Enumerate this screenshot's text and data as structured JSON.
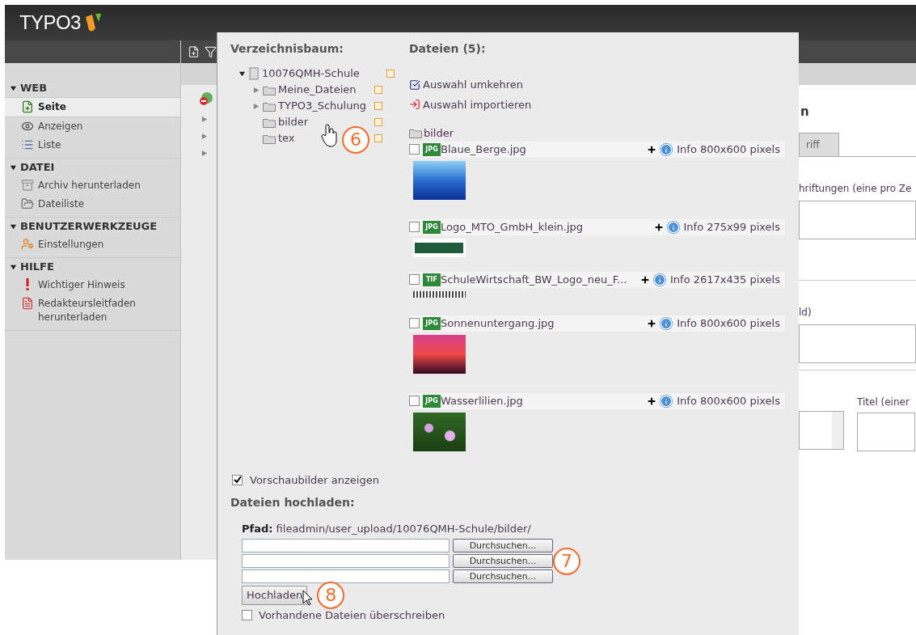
{
  "header": {
    "logo": "TYPO3"
  },
  "sidebar": {
    "sections": [
      {
        "title": "WEB",
        "expanded": true,
        "items": [
          {
            "label": "Seite",
            "kind": "page",
            "selected": true
          },
          {
            "label": "Anzeigen",
            "kind": "view",
            "selected": false
          },
          {
            "label": "Liste",
            "kind": "list",
            "selected": false
          }
        ]
      },
      {
        "title": "DATEI",
        "expanded": true,
        "items": [
          {
            "label": "Archiv herunterladen",
            "kind": "archive",
            "selected": false
          },
          {
            "label": "Dateiliste",
            "kind": "files",
            "selected": false
          }
        ]
      },
      {
        "title": "BENUTZERWERKZEUGE",
        "expanded": true,
        "items": [
          {
            "label": "Einstellungen",
            "kind": "user",
            "selected": false
          }
        ]
      },
      {
        "title": "HILFE",
        "expanded": true,
        "items": [
          {
            "label": "Wichtiger Hinweis",
            "kind": "alert",
            "selected": false
          },
          {
            "label": "Redakteursleitfaden herunterladen",
            "kind": "pdf",
            "selected": false
          }
        ]
      }
    ]
  },
  "background": {
    "heading": "n",
    "tab": "riff",
    "label_1": "hriftungen (eine pro Ze",
    "label_2": "ld)",
    "label_3": "Titel (einer"
  },
  "dialog": {
    "tree": {
      "title": "Verzeichnisbaum:",
      "callout": "6",
      "root": {
        "label": "10076QMH-Schule",
        "expanded": true,
        "children": [
          {
            "label": "Meine_Dateien",
            "expanded": false
          },
          {
            "label": "TYPO3_Schulung",
            "expanded": false
          },
          {
            "label": "bilder"
          },
          {
            "label": "tex"
          }
        ]
      }
    },
    "files": {
      "title": "Dateien (5):",
      "actions": [
        {
          "kind": "invert",
          "label": "Auswahl umkehren"
        },
        {
          "kind": "import",
          "label": "Auswahl importieren"
        }
      ],
      "folder": "bilder",
      "items": [
        {
          "name": "Blaue_Berge.jpg",
          "type": "JPG",
          "checked": false,
          "info": "Info 800x600 pixels"
        },
        {
          "name": "Logo_MTO_GmbH_klein.jpg",
          "type": "JPG",
          "checked": false,
          "info": "Info 275x99 pixels"
        },
        {
          "name": "SchuleWirtschaft_BW_Logo_neu_F...",
          "type": "TIF",
          "checked": false,
          "info": "Info 2617x435 pixels"
        },
        {
          "name": "Sonnenuntergang.jpg",
          "type": "JPG",
          "checked": false,
          "info": "Info 800x600 pixels"
        },
        {
          "name": "Wasserlilien.jpg",
          "type": "JPG",
          "checked": false,
          "info": "Info 800x600 pixels"
        }
      ]
    },
    "thumbnails": {
      "label": "Vorschaubilder anzeigen",
      "checked": true
    },
    "upload": {
      "title": "Dateien hochladen:",
      "path_label": "Pfad:",
      "path": "fileadmin/user_upload/10076QMH-Schule/bilder/",
      "callout": "7",
      "inputs": [
        {
          "button": "Durchsuchen..."
        },
        {
          "button": "Durchsuchen..."
        },
        {
          "button": "Durchsuchen..."
        }
      ],
      "submit": {
        "label": "Hochladen",
        "callout": "8"
      },
      "overwrite": {
        "label": "Vorhandene Dateien überschreiben",
        "checked": false
      }
    }
  }
}
